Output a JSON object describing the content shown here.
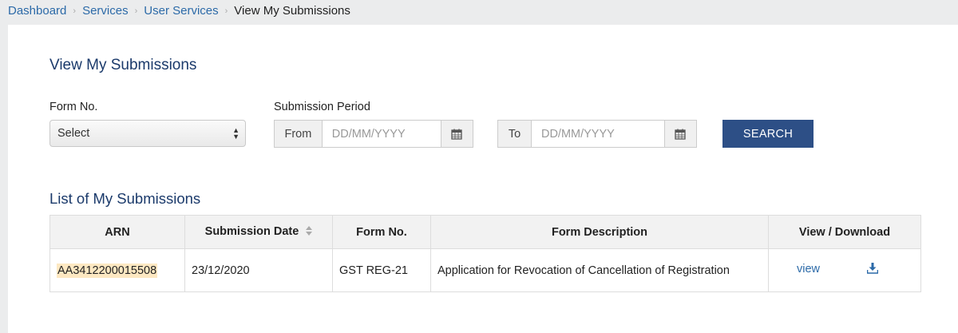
{
  "breadcrumb": {
    "items": [
      "Dashboard",
      "Services",
      "User Services"
    ],
    "current": "View My Submissions",
    "separator": "›"
  },
  "page": {
    "title": "View My Submissions"
  },
  "filters": {
    "form_no_label": "Form No.",
    "form_no_selected": "Select",
    "period_label": "Submission Period",
    "from_label": "From",
    "to_label": "To",
    "from_placeholder": "DD/MM/YYYY",
    "to_placeholder": "DD/MM/YYYY",
    "calendar_icon": "calendar-icon",
    "search_label": "SEARCH"
  },
  "list": {
    "title": "List of My Submissions",
    "columns": [
      "ARN",
      "Submission Date",
      "Form No.",
      "Form Description",
      "View / Download"
    ],
    "sort_icon": "sort-icon",
    "rows": [
      {
        "arn": "AA3412200015508",
        "submission_date": "23/12/2020",
        "form_no": "GST REG-21",
        "form_description": "Application for Revocation of Cancellation of Registration",
        "view_label": "view",
        "download_icon": "download-icon"
      }
    ]
  },
  "colors": {
    "link": "#2c6aa8",
    "heading": "#1b3a6b",
    "button": "#2d4f86",
    "highlight": "#fde8c2",
    "page_bg": "#ebeced"
  }
}
